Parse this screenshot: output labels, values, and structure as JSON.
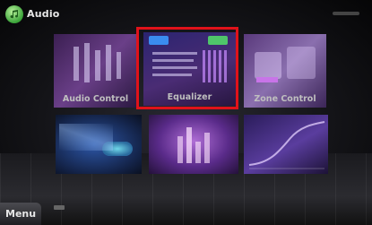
{
  "header": {
    "title": "Audio"
  },
  "tiles": [
    {
      "label": "Audio Control"
    },
    {
      "label": "Equalizer"
    },
    {
      "label": "Zone Control"
    },
    {
      "label": ""
    },
    {
      "label": ""
    },
    {
      "label": ""
    }
  ],
  "footer": {
    "menu_label": "Menu"
  },
  "colors": {
    "selection": "#e0121a",
    "icon": "#3aa339"
  }
}
